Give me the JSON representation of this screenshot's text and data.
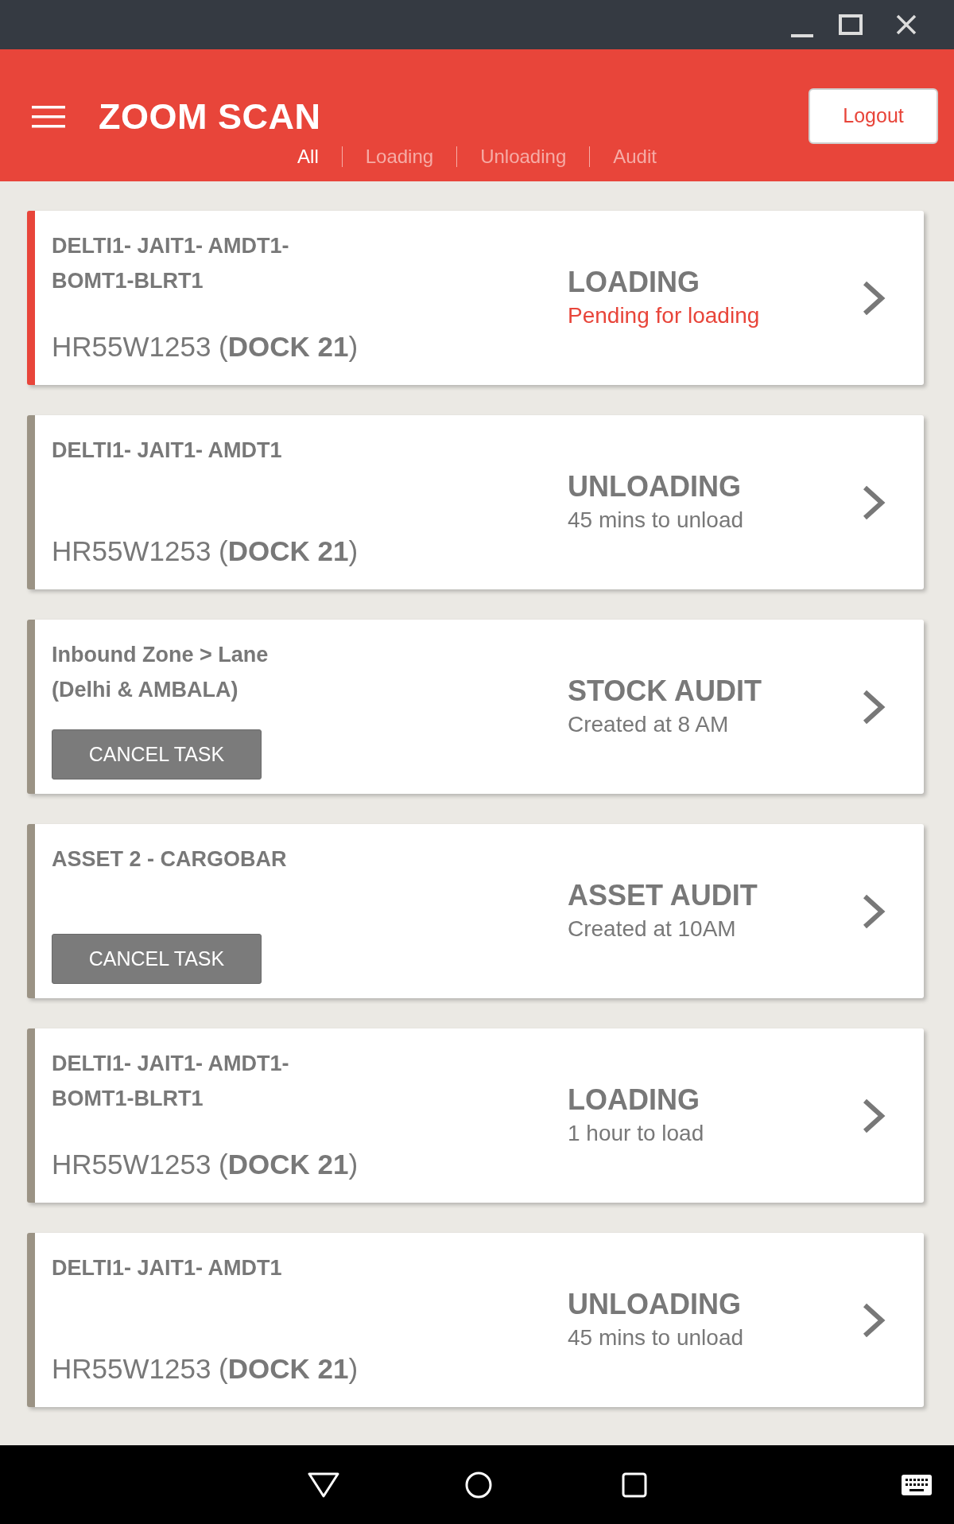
{
  "header": {
    "title": "ZOOM SCAN",
    "logout": "Logout"
  },
  "tabs": [
    {
      "label": "All",
      "selected": true
    },
    {
      "label": "Loading",
      "selected": false
    },
    {
      "label": "Unloading",
      "selected": false
    },
    {
      "label": "Audit",
      "selected": false
    }
  ],
  "tasks": [
    {
      "kind": "shipment",
      "highlighted": true,
      "route": "DELTI1- JAIT1- AMDT1-BOMT1-BLRT1",
      "vehicle": "HR55W1253 (**DOCK 21**)",
      "status": "LOADING",
      "detail": "Pending for loading"
    },
    {
      "kind": "shipment",
      "highlighted": false,
      "route": "DELTI1- JAIT1- AMDT1",
      "vehicle": "HR55W1253 (**DOCK 21**)",
      "status": "UNLOADING",
      "detail": "45 mins to unload"
    },
    {
      "kind": "audit",
      "highlighted": false,
      "route": "Inbound Zone > Lane (Delhi & AMBALA)",
      "action": "CANCEL TASK",
      "status": "STOCK AUDIT",
      "detail": "Created at 8 AM"
    },
    {
      "kind": "audit",
      "highlighted": false,
      "route": "ASSET 2 - CARGOBAR",
      "action": "CANCEL TASK",
      "status": "ASSET AUDIT",
      "detail": "Created at 10AM"
    },
    {
      "kind": "shipment",
      "highlighted": false,
      "route": "DELTI1- JAIT1- AMDT1-BOMT1-BLRT1",
      "vehicle": "HR55W1253 (**DOCK 21**)",
      "status": "LOADING",
      "detail": "1 hour to load"
    },
    {
      "kind": "shipment",
      "highlighted": false,
      "route": "DELTI1- JAIT1- AMDT1",
      "vehicle": "HR55W1253 (**DOCK 21**)",
      "status": "UNLOADING",
      "detail": "45 mins to unload"
    }
  ]
}
